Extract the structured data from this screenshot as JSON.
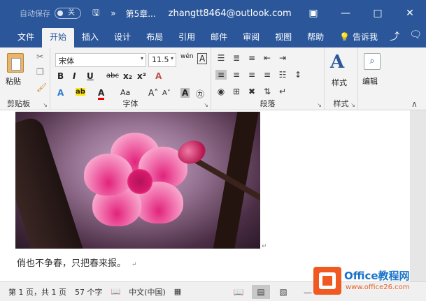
{
  "titlebar": {
    "autosave_label": "自动保存",
    "autosave_state": "关",
    "doc_title": "第5章...",
    "account": "zhangtt8464@outlook.com"
  },
  "tabs": [
    "文件",
    "开始",
    "插入",
    "设计",
    "布局",
    "引用",
    "邮件",
    "审阅",
    "视图",
    "帮助"
  ],
  "tell_me": "告诉我",
  "ribbon": {
    "clipboard": {
      "paste": "粘贴",
      "label": "剪贴板"
    },
    "font": {
      "name": "宋体",
      "size": "11.5",
      "label": "字体"
    },
    "paragraph": {
      "label": "段落"
    },
    "styles": {
      "label": "样式",
      "group_label": "样式"
    },
    "editing": {
      "label": "编辑"
    }
  },
  "document": {
    "text": "俏也不争春，只把春来报。"
  },
  "status": {
    "page": "第 1 页，共 1 页",
    "words": "57 个字",
    "language": "中文(中国)"
  },
  "watermark": {
    "brand": "Office教程网",
    "url": "www.office26.com"
  },
  "colors": {
    "accent": "#2b579a",
    "ribbon_bg": "#f3f3f3"
  }
}
